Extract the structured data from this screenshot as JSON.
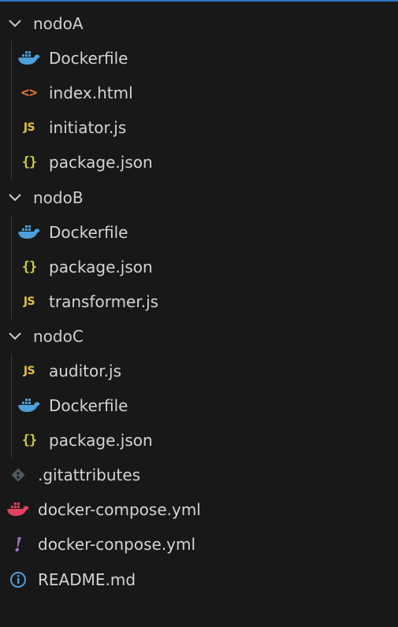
{
  "explorer": {
    "folders": [
      {
        "name": "nodoA",
        "files": [
          {
            "name": "Dockerfile",
            "icon": "docker-icon"
          },
          {
            "name": "index.html",
            "icon": "html-icon"
          },
          {
            "name": "initiator.js",
            "icon": "js-icon"
          },
          {
            "name": "package.json",
            "icon": "json-icon"
          }
        ]
      },
      {
        "name": "nodoB",
        "files": [
          {
            "name": "Dockerfile",
            "icon": "docker-icon"
          },
          {
            "name": "package.json",
            "icon": "json-icon"
          },
          {
            "name": "transformer.js",
            "icon": "js-icon"
          }
        ]
      },
      {
        "name": "nodoC",
        "files": [
          {
            "name": "auditor.js",
            "icon": "js-icon"
          },
          {
            "name": "Dockerfile",
            "icon": "docker-icon"
          },
          {
            "name": "package.json",
            "icon": "json-icon"
          }
        ]
      }
    ],
    "root_files": [
      {
        "name": ".gitattributes",
        "icon": "git-icon"
      },
      {
        "name": "docker-compose.yml",
        "icon": "docker-compose-icon"
      },
      {
        "name": "docker-conpose.yml",
        "icon": "yaml-icon"
      },
      {
        "name": "README.md",
        "icon": "info-icon"
      }
    ]
  },
  "icon_glyphs": {
    "js": "JS",
    "json": "{}",
    "html": "<>",
    "yaml": "!"
  },
  "colors": {
    "background": "#181818",
    "accent": "#2b79c2",
    "docker": "#4d9fd8",
    "docker_compose": "#e0435d",
    "js": "#e5c03c",
    "json": "#cbcb41",
    "html": "#e37933",
    "yaml": "#a074c4",
    "git": "#4d5a5e",
    "info": "#4d9fd8"
  }
}
